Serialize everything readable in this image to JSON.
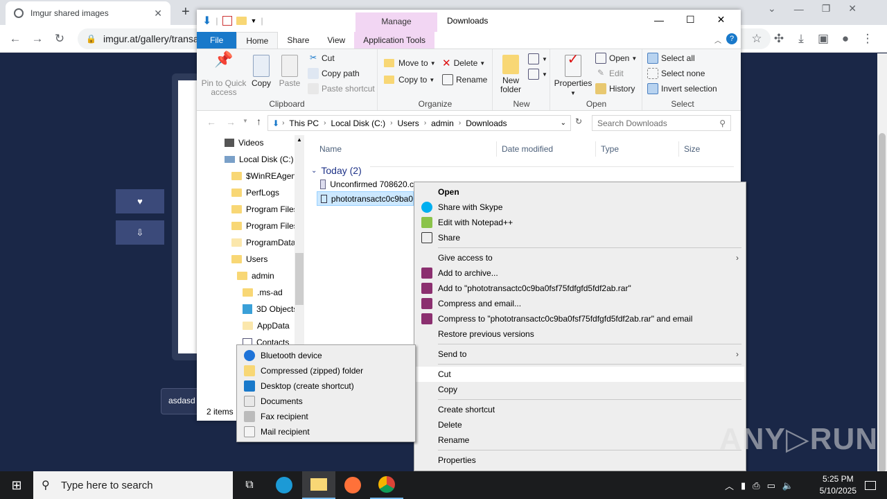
{
  "chrome": {
    "tab_title": "Imgur shared images",
    "url": "imgur.at/gallery/transa",
    "new_tab": "+"
  },
  "page": {
    "side_btn_1": "♥",
    "side_btn_2": "⇩",
    "comment_text": "asdasd"
  },
  "explorer": {
    "title": "Downloads",
    "manage_label": "Manage",
    "tabs": [
      "File",
      "Home",
      "Share",
      "View",
      "Application Tools"
    ],
    "clipboard": {
      "pin": "Pin to Quick access",
      "copy": "Copy",
      "paste": "Paste",
      "cut": "Cut",
      "copy_path": "Copy path",
      "paste_shortcut": "Paste shortcut",
      "label": "Clipboard"
    },
    "organize": {
      "move_to": "Move to",
      "copy_to": "Copy to",
      "delete": "Delete",
      "rename": "Rename",
      "label": "Organize"
    },
    "new": {
      "new_folder": "New folder",
      "label": "New"
    },
    "open": {
      "properties": "Properties",
      "open": "Open",
      "edit": "Edit",
      "history": "History",
      "label": "Open"
    },
    "select": {
      "select_all": "Select all",
      "select_none": "Select none",
      "invert": "Invert selection",
      "label": "Select"
    },
    "breadcrumb": [
      "This PC",
      "Local Disk (C:)",
      "Users",
      "admin",
      "Downloads"
    ],
    "search_placeholder": "Search Downloads",
    "nav": [
      "Videos",
      "Local Disk (C:)",
      "$WinREAgent",
      "PerfLogs",
      "Program Files",
      "Program Files",
      "ProgramData",
      "Users",
      "admin",
      ".ms-ad",
      "3D Objects",
      "AppData",
      "Contacts"
    ],
    "columns": [
      "Name",
      "Date modified",
      "Type",
      "Size"
    ],
    "group": "Today (2)",
    "files": [
      "Unconfirmed 708620.c",
      "phototransactc0c9ba0"
    ],
    "status": "2 items"
  },
  "context_menu": {
    "open": "Open",
    "skype": "Share with Skype",
    "notepad": "Edit with Notepad++",
    "share": "Share",
    "give_access": "Give access to",
    "add_archive": "Add to archive...",
    "add_rar": "Add to \"phototransactc0c9ba0fsf75fdfgfd5fdf2ab.rar\"",
    "compress_email": "Compress and email...",
    "compress_rar_email": "Compress to \"phototransactc0c9ba0fsf75fdfgfd5fdf2ab.rar\" and email",
    "restore": "Restore previous versions",
    "send_to": "Send to",
    "cut": "Cut",
    "copy": "Copy",
    "create_shortcut": "Create shortcut",
    "delete": "Delete",
    "rename": "Rename",
    "properties": "Properties"
  },
  "send_to_menu": [
    "Bluetooth device",
    "Compressed (zipped) folder",
    "Desktop (create shortcut)",
    "Documents",
    "Fax recipient",
    "Mail recipient"
  ],
  "taskbar": {
    "search_placeholder": "Type here to search",
    "time": "5:25 PM",
    "date": "5/10/2025"
  },
  "watermark": "ANY▷RUN"
}
